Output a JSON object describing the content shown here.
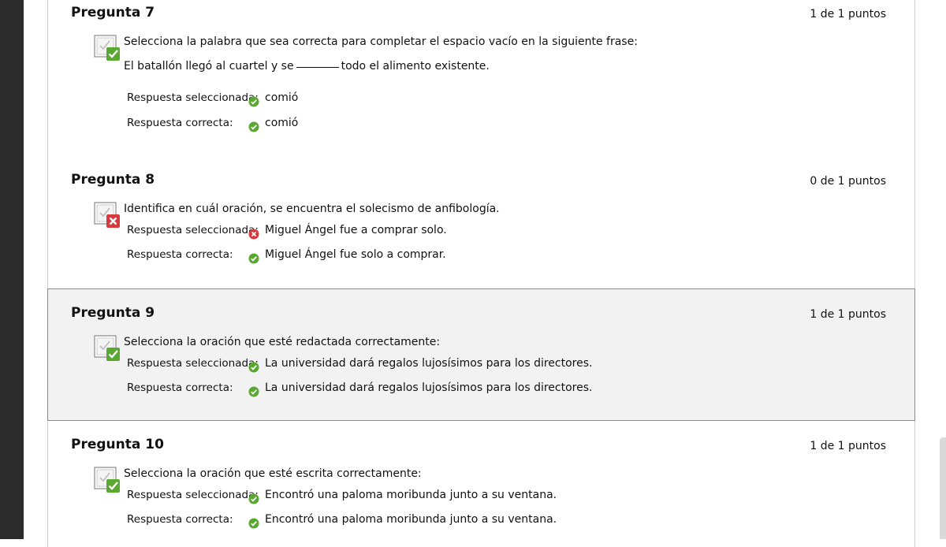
{
  "questions": [
    {
      "title": "Pregunta 7",
      "points": "1 de 1 puntos",
      "status": "correct",
      "prompt_lines": [
        "Selecciona la palabra que sea correcta para completar el espacio vacío en la siguiente frase:",
        {
          "before": "El batallón llegó al cuartel y se",
          "after": "todo el alimento existente."
        }
      ],
      "selected_label": "Respuesta seleccionada:",
      "selected_answer": "comió",
      "selected_status": "correct",
      "correct_label": "Respuesta correcta:",
      "correct_answer": "comió"
    },
    {
      "title": "Pregunta 8",
      "points": "0 de 1 puntos",
      "status": "incorrect",
      "prompt_lines": [
        "Identifica en cuál oración, se encuentra el solecismo de anfibología."
      ],
      "selected_label": "Respuesta seleccionada:",
      "selected_answer": "Miguel Ángel fue a comprar solo.",
      "selected_status": "incorrect",
      "correct_label": "Respuesta correcta:",
      "correct_answer": "Miguel Ángel fue solo a comprar."
    },
    {
      "title": "Pregunta 9",
      "points": "1 de 1 puntos",
      "status": "correct",
      "prompt_lines": [
        "Selecciona la oración que esté redactada correctamente:"
      ],
      "selected_label": "Respuesta seleccionada:",
      "selected_answer": "La universidad dará regalos lujosísimos para los directores.",
      "selected_status": "correct",
      "correct_label": "Respuesta correcta:",
      "correct_answer": "La universidad dará regalos lujosísimos para los directores."
    },
    {
      "title": "Pregunta 10",
      "points": "1 de 1 puntos",
      "status": "correct",
      "prompt_lines": [
        "Selecciona la oración que esté escrita correctamente:"
      ],
      "selected_label": "Respuesta seleccionada:",
      "selected_answer": "Encontró una paloma moribunda junto a su ventana.",
      "selected_status": "correct",
      "correct_label": "Respuesta correcta:",
      "correct_answer": "Encontró una paloma moribunda junto a su ventana."
    }
  ],
  "colors": {
    "correct": "#5aa832",
    "incorrect": "#d63a3a",
    "highlight_bg": "#f2f2f2",
    "left_rail": "#2b2b2b"
  }
}
